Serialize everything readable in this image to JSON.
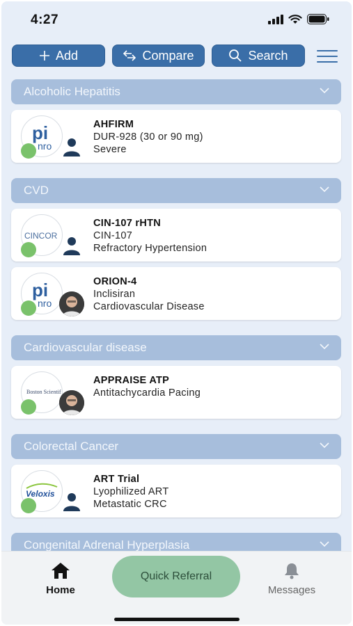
{
  "status_bar": {
    "time": "4:27"
  },
  "toolbar": {
    "add_label": "Add",
    "compare_label": "Compare",
    "search_label": "Search"
  },
  "categories": [
    {
      "name": "Alcoholic Hepatitis",
      "trials": [
        {
          "title": "AHFIRM",
          "line2": "DUR-928 (30 or 90 mg)",
          "line3": "Severe",
          "logo": "pi-logo",
          "logo_text": "nro",
          "avatar": "person-icon"
        }
      ]
    },
    {
      "name": "CVD",
      "trials": [
        {
          "title": "CIN-107 rHTN",
          "line2": "CIN-107",
          "line3": "Refractory Hypertension",
          "logo": "cincor-logo",
          "logo_text": "CINCOR",
          "avatar": "person-icon"
        },
        {
          "title": "ORION-4",
          "line2": "Inclisiran",
          "line3": "Cardiovascular Disease",
          "logo": "pi-logo",
          "logo_text": "nro",
          "avatar": "photo"
        }
      ]
    },
    {
      "name": "Cardiovascular disease",
      "trials": [
        {
          "title": "APPRAISE ATP",
          "line2": "Antitachycardia Pacing",
          "line3": "",
          "logo": "boston-scientific-logo",
          "logo_text": "Boston Scientific",
          "avatar": "photo"
        }
      ]
    },
    {
      "name": "Colorectal Cancer",
      "trials": [
        {
          "title": "ART Trial",
          "line2": "Lyophilized ART",
          "line3": "Metastatic CRC",
          "logo": "veloxis-logo",
          "logo_text": "Veloxis",
          "avatar": "person-icon"
        }
      ]
    },
    {
      "name": "Congenital Adrenal Hyperplasia",
      "trials": []
    }
  ],
  "tabbar": {
    "home_label": "Home",
    "quick_referral_label": "Quick Referral",
    "messages_label": "Messages"
  },
  "colors": {
    "primary": "#3a6ea8",
    "category_header": "#a7bedc",
    "background": "#e7eef8",
    "status_green": "#7ac26b",
    "quick_referral": "#93c6a4"
  }
}
